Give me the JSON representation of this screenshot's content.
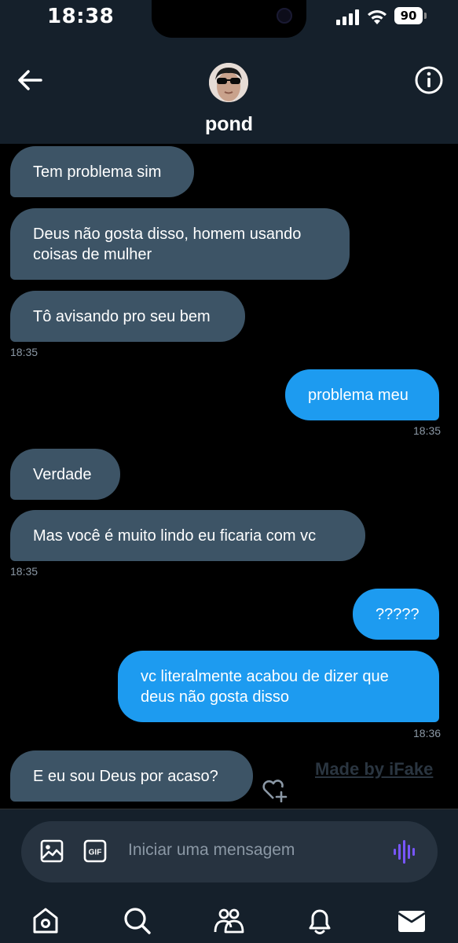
{
  "status_bar": {
    "time": "18:38",
    "battery": "90"
  },
  "header": {
    "contact_name": "pond"
  },
  "messages": [
    {
      "dir": "in",
      "text": "Tem problema sim"
    },
    {
      "dir": "in",
      "text": "Deus não gosta disso, homem usando coisas de mulher"
    },
    {
      "dir": "in",
      "text": "Tô avisando pro seu bem",
      "time": "18:35"
    },
    {
      "dir": "out",
      "text": "problema meu",
      "time": "18:35"
    },
    {
      "dir": "in",
      "text": "Verdade"
    },
    {
      "dir": "in",
      "text": "Mas você é muito lindo eu ficaria com vc",
      "time": "18:35"
    },
    {
      "dir": "out",
      "text": "?????"
    },
    {
      "dir": "out",
      "text": "vc literalmente acabou de dizer que deus não gosta disso",
      "time": "18:36"
    },
    {
      "dir": "in",
      "text": "E eu sou Deus por acaso?"
    }
  ],
  "watermark": "Made by iFake",
  "composer": {
    "placeholder": "Iniciar uma mensagem",
    "gif_label": "GIF"
  },
  "tabs": [
    "home-icon",
    "search-icon",
    "communities-icon",
    "notifications-icon",
    "messages-icon"
  ],
  "colors": {
    "incoming_bubble": "#3d5466",
    "outgoing_bubble": "#1d9bf0",
    "accent": "#1d9bf0",
    "voice": "#7856ff"
  }
}
